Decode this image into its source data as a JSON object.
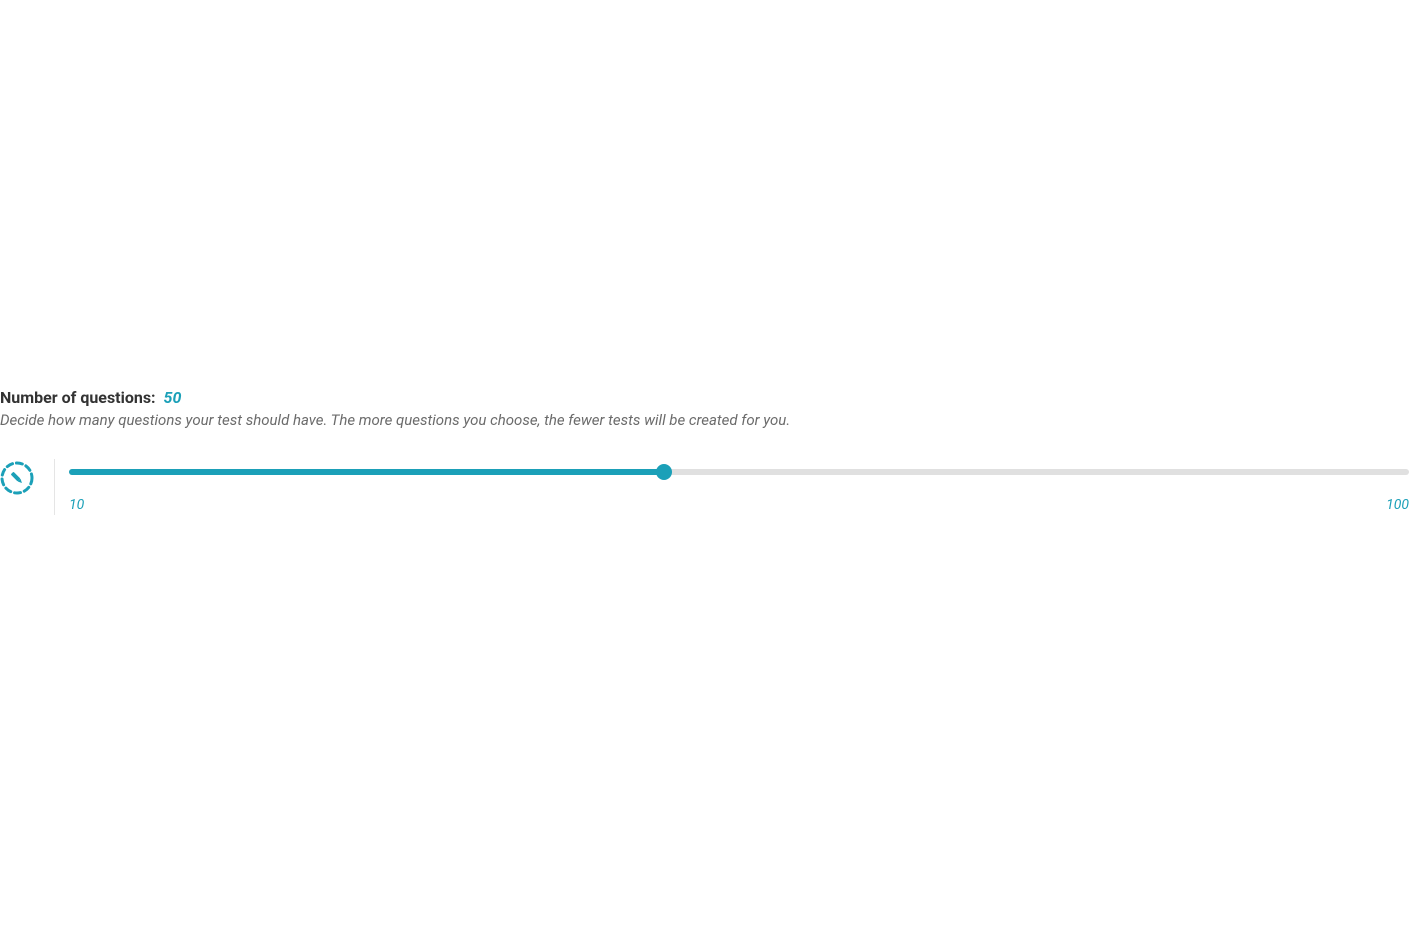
{
  "questions": {
    "label": "Number of questions:",
    "value": "50",
    "description": "Decide how many questions your test should have. The more questions you choose, the fewer tests will be created for you.",
    "slider": {
      "min_label": "10",
      "max_label": "100"
    }
  },
  "colors": {
    "accent": "#1ba0b8"
  }
}
